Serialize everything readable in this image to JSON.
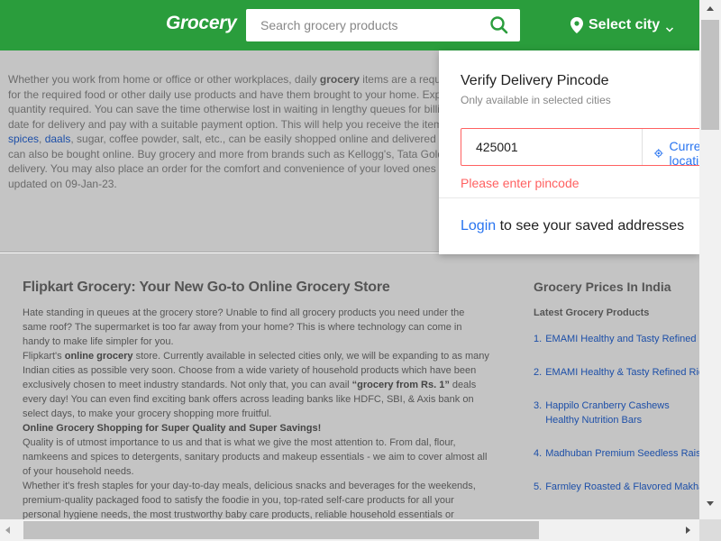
{
  "header": {
    "logo": "Grocery",
    "search_placeholder": "Search grocery products",
    "search_icon": "search-icon",
    "city_label": "Select city",
    "brand_color": "#2a9d3c"
  },
  "info": {
    "p1": "Whether you work from home or office or other workplaces, daily ",
    "b1": "grocery",
    "p2": " items are a requisi",
    "p3": "for the required food or other daily use products and have them brought to your home. Explo",
    "p4": "quantity required. You can save the time otherwise lost in waiting in lengthy queues for billin",
    "p5": "date for delivery and pay with a suitable payment option. This will help you receive the items",
    "link1": "spices",
    "sep1": ", ",
    "link2": "daals",
    "p6": ", sugar, coffee powder, salt, etc., can be easily shopped online and delivered to y",
    "p7": "can also be bought online. Buy grocery and more from brands such as Kellogg's, Tata Gold, F",
    "p8": "delivery. You may also place an order for the comfort and convenience of your loved ones wh",
    "p9": "updated on 09-Jan-23."
  },
  "main": {
    "heading": "Flipkart Grocery: Your New Go-to Online Grocery Store",
    "para1": "Hate standing in queues at the grocery store? Unable to find all grocery products you need under the same roof? The supermarket is too far away from your home? This is where technology can come in handy to make life simpler for you.",
    "para2a": "Flipkart's ",
    "para2b": "online grocery",
    "para2c": " store. Currently available in selected cities only, we will be expanding to as many Indian cities as possible very soon. Choose from a wide variety of household products which have been exclusively chosen to meet industry standards. Not only that, you can avail ",
    "para2d": "“grocery from Rs. 1”",
    "para2e": " deals every day! You can even find exciting bank offers across leading banks like HDFC, SBI, & Axis bank on select days, to make your grocery shopping more fruitful.",
    "subhead": "Online Grocery Shopping for Super Quality and Super Savings!",
    "para3": "Quality is of utmost importance to us and that is what we give the most attention to. From dal, flour, namkeens and spices to detergents, sanitary products and makeup essentials - we aim to cover almost all of your household needs.",
    "para4": "Whether it's fresh staples for your day-to-day meals, delicious snacks and beverages for the weekends, premium-quality packaged food to satisfy the foodie in you, top-rated self-care products for all your personal hygiene needs, the most trustworthy baby care products, reliable household essentials or delectable dairy"
  },
  "side": {
    "heading": "Grocery Prices In India",
    "sub": "Latest Grocery Products",
    "items": [
      {
        "n": "1.",
        "t": "EMAMI Healthy and Tasty Refined S"
      },
      {
        "n": "2.",
        "t": "EMAMI Healthy & Tasty Refined Rice"
      },
      {
        "n": "3.",
        "t": "Happilo Cranberry Cashews Healthy Nutrition Bars"
      },
      {
        "n": "4.",
        "t": "Madhuban Premium Seedless Raisi"
      },
      {
        "n": "5.",
        "t": "Farmley Roasted & Flavored Makha"
      }
    ]
  },
  "popup": {
    "title": "Verify Delivery Pincode",
    "subtitle": "Only available in selected cities",
    "pincode_value": "425001",
    "current_location": "Current location",
    "error": "Please enter pincode",
    "login": "Login",
    "login_suffix": " to see your saved addresses",
    "link_color": "#2874f0",
    "error_color": "#ff6161"
  }
}
